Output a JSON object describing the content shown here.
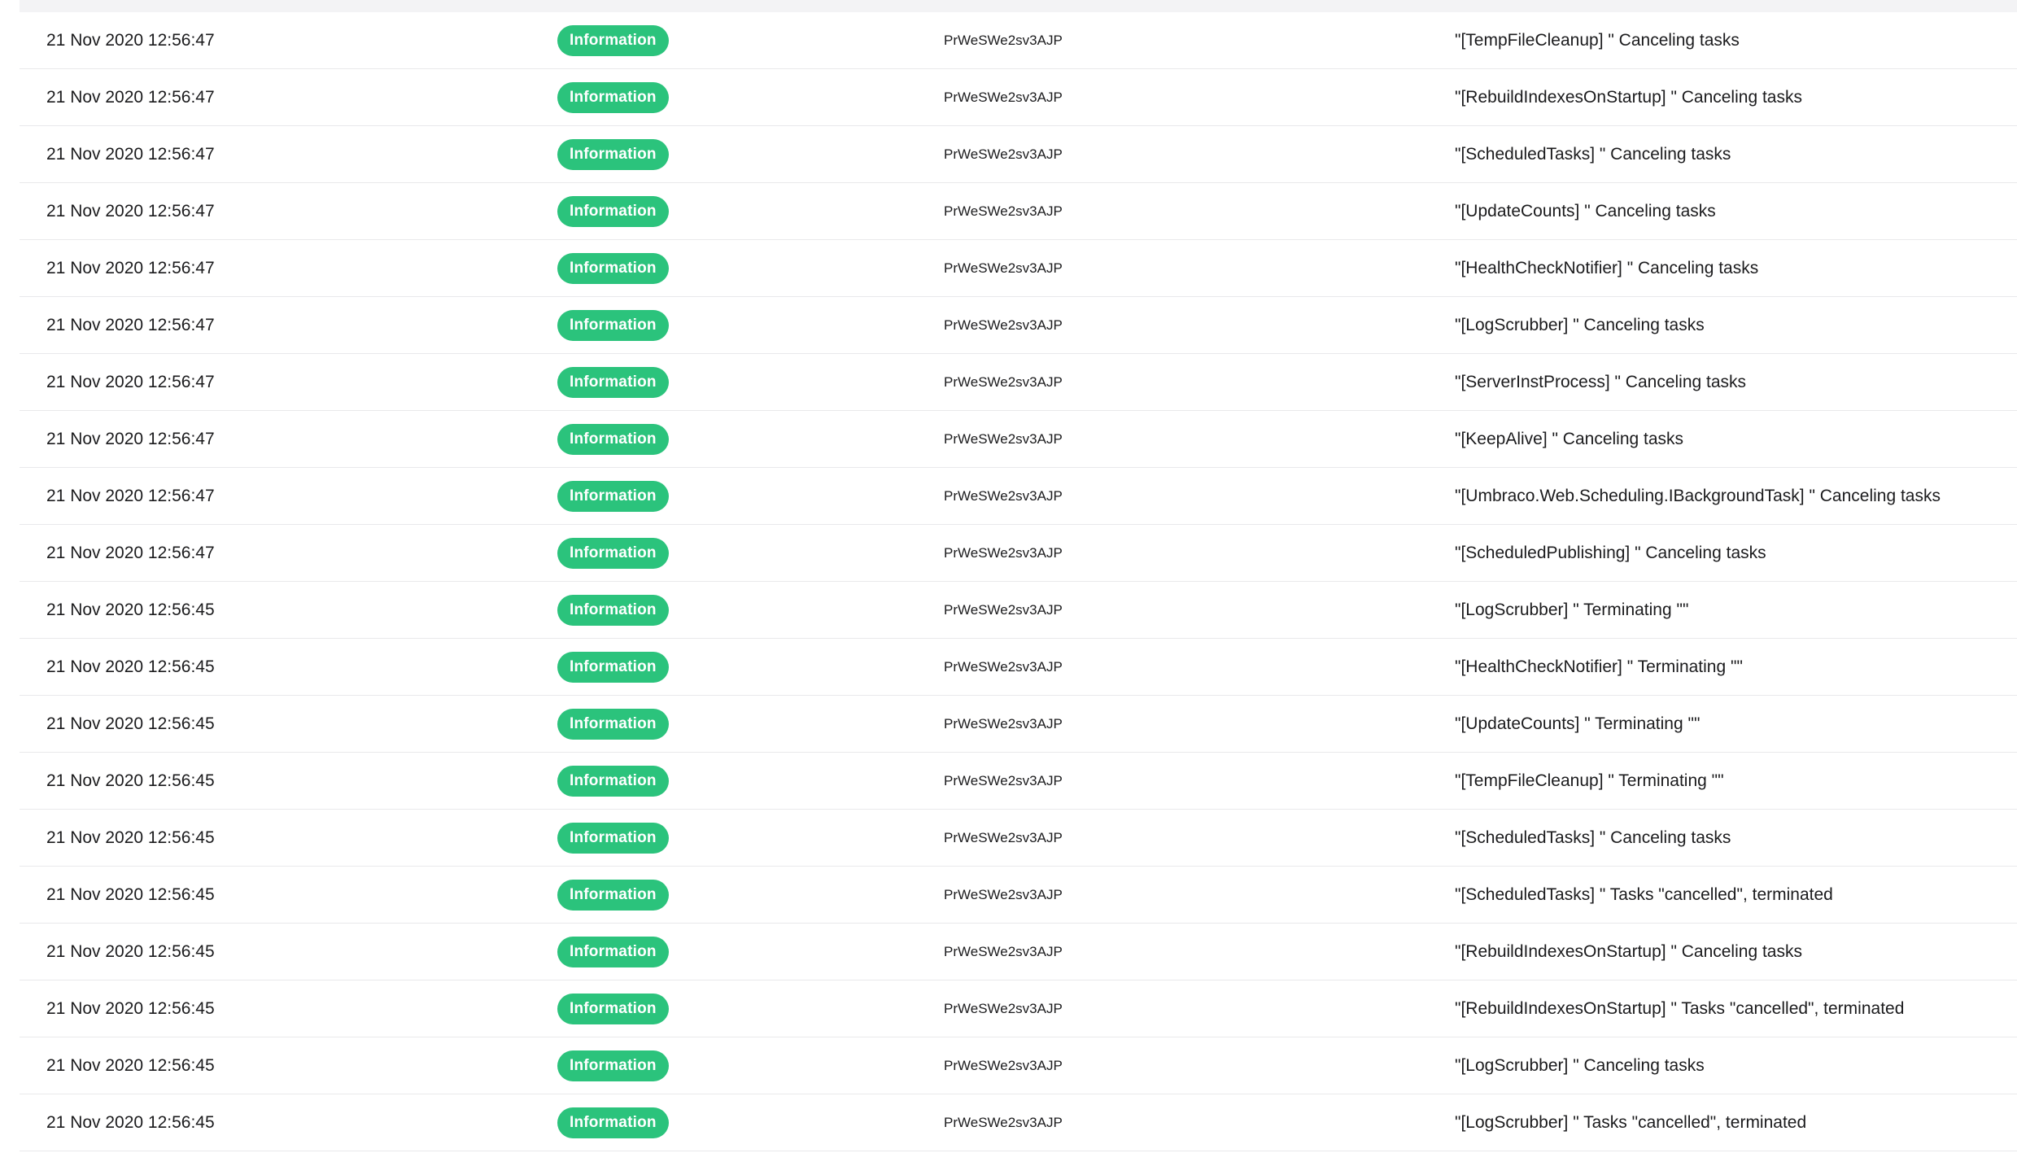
{
  "log": {
    "level_color": "#2bc37c",
    "rows": [
      {
        "timestamp": "21 Nov 2020 12:56:47",
        "level": "Information",
        "machine": "PrWeSWe2sv3AJP",
        "message": "\"[TempFileCleanup] \" Canceling tasks"
      },
      {
        "timestamp": "21 Nov 2020 12:56:47",
        "level": "Information",
        "machine": "PrWeSWe2sv3AJP",
        "message": "\"[RebuildIndexesOnStartup] \" Canceling tasks"
      },
      {
        "timestamp": "21 Nov 2020 12:56:47",
        "level": "Information",
        "machine": "PrWeSWe2sv3AJP",
        "message": "\"[ScheduledTasks] \" Canceling tasks"
      },
      {
        "timestamp": "21 Nov 2020 12:56:47",
        "level": "Information",
        "machine": "PrWeSWe2sv3AJP",
        "message": "\"[UpdateCounts] \" Canceling tasks"
      },
      {
        "timestamp": "21 Nov 2020 12:56:47",
        "level": "Information",
        "machine": "PrWeSWe2sv3AJP",
        "message": "\"[HealthCheckNotifier] \" Canceling tasks"
      },
      {
        "timestamp": "21 Nov 2020 12:56:47",
        "level": "Information",
        "machine": "PrWeSWe2sv3AJP",
        "message": "\"[LogScrubber] \" Canceling tasks"
      },
      {
        "timestamp": "21 Nov 2020 12:56:47",
        "level": "Information",
        "machine": "PrWeSWe2sv3AJP",
        "message": "\"[ServerInstProcess] \" Canceling tasks"
      },
      {
        "timestamp": "21 Nov 2020 12:56:47",
        "level": "Information",
        "machine": "PrWeSWe2sv3AJP",
        "message": "\"[KeepAlive] \" Canceling tasks"
      },
      {
        "timestamp": "21 Nov 2020 12:56:47",
        "level": "Information",
        "machine": "PrWeSWe2sv3AJP",
        "message": "\"[Umbraco.Web.Scheduling.IBackgroundTask] \" Canceling tasks"
      },
      {
        "timestamp": "21 Nov 2020 12:56:47",
        "level": "Information",
        "machine": "PrWeSWe2sv3AJP",
        "message": "\"[ScheduledPublishing] \" Canceling tasks"
      },
      {
        "timestamp": "21 Nov 2020 12:56:45",
        "level": "Information",
        "machine": "PrWeSWe2sv3AJP",
        "message": "\"[LogScrubber] \" Terminating \"\""
      },
      {
        "timestamp": "21 Nov 2020 12:56:45",
        "level": "Information",
        "machine": "PrWeSWe2sv3AJP",
        "message": "\"[HealthCheckNotifier] \" Terminating \"\""
      },
      {
        "timestamp": "21 Nov 2020 12:56:45",
        "level": "Information",
        "machine": "PrWeSWe2sv3AJP",
        "message": "\"[UpdateCounts] \" Terminating \"\""
      },
      {
        "timestamp": "21 Nov 2020 12:56:45",
        "level": "Information",
        "machine": "PrWeSWe2sv3AJP",
        "message": "\"[TempFileCleanup] \" Terminating \"\""
      },
      {
        "timestamp": "21 Nov 2020 12:56:45",
        "level": "Information",
        "machine": "PrWeSWe2sv3AJP",
        "message": "\"[ScheduledTasks] \" Canceling tasks"
      },
      {
        "timestamp": "21 Nov 2020 12:56:45",
        "level": "Information",
        "machine": "PrWeSWe2sv3AJP",
        "message": "\"[ScheduledTasks] \" Tasks \"cancelled\", terminated"
      },
      {
        "timestamp": "21 Nov 2020 12:56:45",
        "level": "Information",
        "machine": "PrWeSWe2sv3AJP",
        "message": "\"[RebuildIndexesOnStartup] \" Canceling tasks"
      },
      {
        "timestamp": "21 Nov 2020 12:56:45",
        "level": "Information",
        "machine": "PrWeSWe2sv3AJP",
        "message": "\"[RebuildIndexesOnStartup] \" Tasks \"cancelled\", terminated"
      },
      {
        "timestamp": "21 Nov 2020 12:56:45",
        "level": "Information",
        "machine": "PrWeSWe2sv3AJP",
        "message": "\"[LogScrubber] \" Canceling tasks"
      },
      {
        "timestamp": "21 Nov 2020 12:56:45",
        "level": "Information",
        "machine": "PrWeSWe2sv3AJP",
        "message": "\"[LogScrubber] \" Tasks \"cancelled\", terminated"
      }
    ]
  }
}
